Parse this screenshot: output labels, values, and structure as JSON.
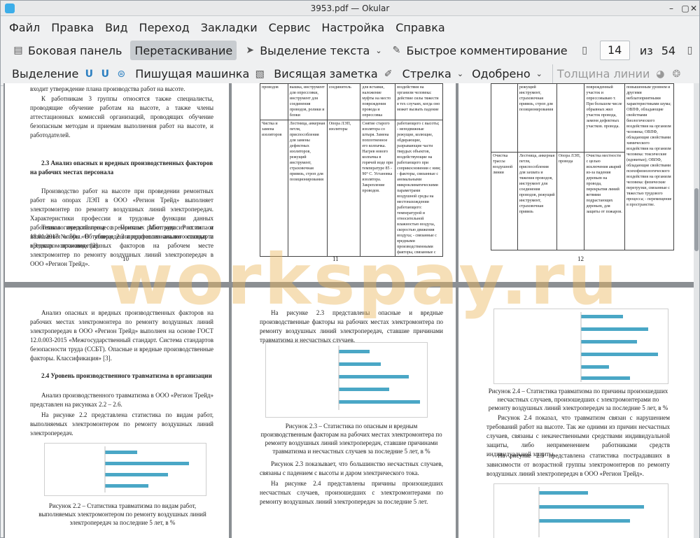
{
  "window": {
    "title": "3953.pdf — Okular"
  },
  "menu": [
    "Файл",
    "Правка",
    "Вид",
    "Переход",
    "Закладки",
    "Сервис",
    "Настройка",
    "Справка"
  ],
  "toolbar1": {
    "sidebar": "Боковая панель",
    "drag": "Перетаскивание",
    "text_select": "Выделение текста",
    "quick_comment": "Быстрое комментирование",
    "page_current": "14",
    "page_of": "из",
    "page_total": "54"
  },
  "toolbar2": {
    "highlight": "Выделение",
    "typewriter": "Пишущая машинка",
    "sticky": "Висящая заметка",
    "arrow": "Стрелка",
    "approved": "Одобрено",
    "line_width": "Толщина линии"
  },
  "watermark": "workspay.ru",
  "pages": {
    "p10": {
      "t1": "входит утверждение плана производства работ на высоте.",
      "t2": "К работникам 3 группы относятся также специалисты, проводящие обучение работам на высоте, а также члены аттестационных комиссий организаций, проводящих обучение безопасным методам и приемам выполнения работ на высоте, и работодателей.",
      "h1": "2.3 Анализ опасных и вредных производственных факторов на рабочих местах персонала",
      "t3": "Производство работ на высоте при проведении ремонтных работ на опорах ЛЭП в ООО «Регион Трейд» выполняет электромонтер по ремонту воздушных линий электропередач. Характеристики профессии и трудовые функции данных работников представлены в Приказе Минтруда России от 18.01.2017 № 50н «Об утверждении профессионального стандарта «Электромонтажник» [2].",
      "t4": "Технологический процесс ремонтных работ зависит от типа и назначения опоры. В таблице 2.2 представлен анализ опасных и вредных производственных факторов на рабочем месте электромонтер по ремонту воздушных линий электропередач в ООО «Регион Трейд».",
      "num": "10"
    },
    "p11": {
      "c1a": "проводов",
      "c2a": "вышка, инструмент для опрессовки, инструмент для соединения проводов, ролики и блоки",
      "c3a": "соединитель",
      "c4a": "для вставки, наложение муфты на место повреждения провода и опрессовка",
      "c5a": "воздействия на организм человека: действие силы тяжести в тех случаях, когда оно может вызвать падение",
      "c1b": "Чистка и замена изоляторов",
      "c2b": "Лестница, анкерная петля, приспособления для замены дефектных изоляторов, режущий инструмент, страховочная привязь, строп для позиционирования",
      "c3b": "Опора ЛЭП, изоляторы",
      "c4b": "Снятие старого изолятора со штыря. Замена поплотненное его колпачка. Нагрев нового колпачка в горячей воде при температуре 85 - 90° С. Установка изолятора. Закрепление проводов.",
      "c5b": "работающего с высоты; - неподвижные режущие, колющие, обдирающие, разрывающие части твердых объектов, воздействующие на работающего при соприкосновении с ним; - факторы, связанные с аномальными микроклиматическими параметрами воздушной среды на местонахождении работающего: температурой и относительной влажностью воздуха, скоростью движения воздуха; - связанные с вредными производственными факторы, связанные с",
      "num": "11"
    },
    "p12": {
      "c2a": "режущий инструмент, страховочная привязь, строп для позиционирования",
      "c4a": "поврежденный участок и опрессовываю т. При большом числе обрывных жил участок провода, заменя дефектных участков. провода.",
      "c5a": "повышенным уровнем и другими неблагоприятными характеристиками шума; ОВПФ, обладающие свойствами биологического воздействия на организм человека; ОВПФ, обладающие свойствами химического воздействия на организм человека: токсические (ядовитые); ОВПФ, обладающие свойствами психофизиологического воздействия на организм человека: физические перегрузки, связанные с тяжестью трудового процесса; - перемещение в пространстве.",
      "c1b": "Очистка трассы воздушной линии",
      "c2b": "Лестница, анкерная петля, приспособления для захвата и тяжения проводов, инструмент для соединения проводов, режущий инструмент, страховочная привязь",
      "c3b": "Опора ЛЭП, провода",
      "c4b": "Очистка местности с целью исключения аварий из-за падения деревьев на провода, перекрытия линий ветвями подрастающих деревьев, для защиты от пожаров.",
      "num": "12"
    },
    "p13": {
      "t1": "Анализ опасных и вредных производственных факторов на рабочих местах электромонтера по ремонту воздушных линий электропередач в ООО «Регион Трейд» выполнен на основе ГОСТ 12.0.003-2015 «Межгосударственный стандарт. Система стандартов безопасности труда (ССБТ). Опасные и вредные производственные факторы. Классификация» [3].",
      "h1": "2.4 Уровень производственного травматизма в организации",
      "t2": "Анализ производственного травматизма в ООО «Регион Трейд» представлен на рисунках 2.2 – 2.6.",
      "t3": "На рисунке 2.2 представлена статистика по видам работ, выполняемых электромонтером по ремонту воздушных линий электропередач.",
      "cap": "Рисунок 2.2 – Статистика травматизма по видам работ, выполняемых электромонтером по ремонту воздушных линий электропередач за последние 5 лет, в %"
    },
    "p14": {
      "t1": "На рисунке 2.3 представлены опасные и вредные производственные факторы на рабочих местах электромонтера по ремонту воздушных линий электропередач, ставшие причинами травматизма и несчастных случаев.",
      "cap": "Рисунок 2.3 – Статистика по опасным и вредным производственным факторам на рабочих местах электромонтера по ремонту воздушных линий электропередач, ставшие причинами травматизма и несчастных случаев за последние 5 лет, в %",
      "t2": "Рисунок 2.3 показывает, что большинство несчастных случаев, связаны с падением с высоты и даром электрического тока.",
      "t3": "На рисунке 2.4 представлены причины произошедших несчастных случаев, произошедших с электромонтерами по ремонту воздушных линий электропередач за последние 5 лет."
    },
    "p15": {
      "cap": "Рисунок 2.4 – Статистика травматизма по причины произошедших несчастных случаев, произошедших с электромонтерами по ремонту воздушных линий электропередач за последние 5 лет, в %",
      "t1": "Рисунок 2.4 показал, что травматизм связан с нарушением требований работ на высоте. Так же одними из причин несчастных случаев, связаны с некачественными средствами индивидуальной защиты, либо неприменением работниками средств индивидуальной защиты.",
      "t2": "На рисунке 2.5 представлена статистика пострадавших в зависимости от возрастной группы электромонтеров по ремонту воздушных линий электропередач в ООО «Регион Трейд»."
    }
  },
  "colors": {
    "accent": "#3daee9",
    "bar": "#4aa7c6",
    "watermark": "#ebb95f"
  }
}
